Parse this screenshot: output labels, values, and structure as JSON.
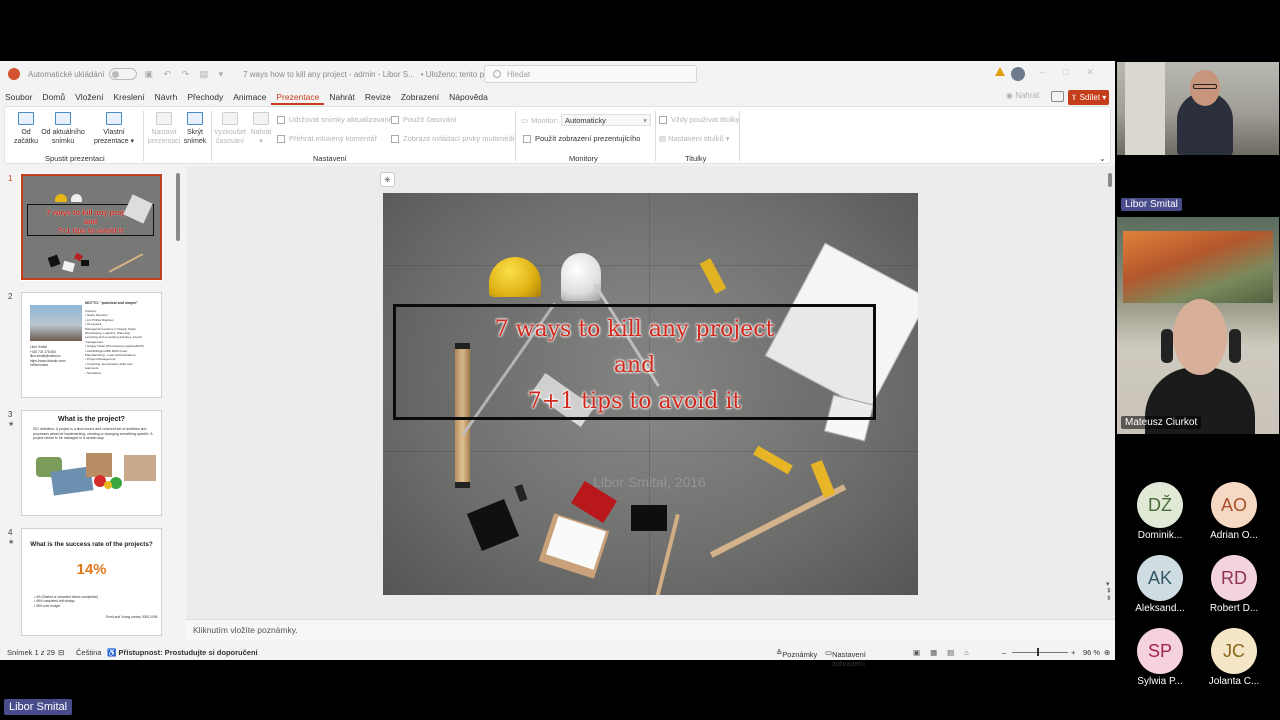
{
  "window": {
    "autosave_label": "Automatické ukládání",
    "doc_title": "7 ways how to kill any project - admin - Libor S...",
    "save_status": "• Uloženo: tento počítač",
    "search_placeholder": "Hledat"
  },
  "menu": {
    "items": [
      "Soubor",
      "Domů",
      "Vložení",
      "Kreslení",
      "Návrh",
      "Přechody",
      "Animace",
      "Prezentace",
      "Nahrát",
      "Revize",
      "Zobrazení",
      "Nápověda"
    ],
    "active": "Prezentace",
    "record_label": "Nahrát",
    "share_label": "Sdílet"
  },
  "ribbon": {
    "from_start": [
      "Od",
      "začátku"
    ],
    "from_current": [
      "Od aktuálního",
      "snímku"
    ],
    "custom": [
      "Vlastní",
      "prezentace"
    ],
    "group_start": "Spustit prezentaci",
    "setup": [
      "Nastavit",
      "prezentaci"
    ],
    "hide": [
      "Skrýt",
      "snímek"
    ],
    "rehearse": [
      "Vyzkoušet",
      "časování"
    ],
    "record": "Nahrát",
    "keep_updated": "Udržovat snímky aktualizované",
    "play_narrations": "Přehrát mluvený komentář",
    "use_timings": "Použít časování",
    "show_media_controls": "Zobrazit ovládací prvky multimédií",
    "group_setup": "Nastavení",
    "monitor_label": "Monitor:",
    "monitor_value": "Automaticky",
    "presenter_view": "Použít zobrazení prezentujícího",
    "group_monitors": "Monitory",
    "always_subtitles": "Vždy používat titulky",
    "subtitle_settings": "Nastavení titulků",
    "group_captions": "Titulky"
  },
  "thumbnails": [
    {
      "num": "1",
      "title": "7 ways to kill any project and 7+1 tips to avoid it"
    },
    {
      "num": "2",
      "title": "MOTTO: \"practical and simple\""
    },
    {
      "num": "3",
      "title": "What is the project?"
    },
    {
      "num": "4",
      "title": "What is the success rate of the projects?",
      "big": "14%"
    }
  ],
  "thumb_text": {
    "s2_left": [
      "Libor Smital",
      "+420 724 378 805",
      "libor.smital@smital.cz",
      "https://www.linkedin.com/",
      "in/liborsmital"
    ],
    "s2_right": [
      "Careers:",
      "• Nokia Siemens",
      "• LG Philips Displays",
      "• Honeywell",
      "Managerial positions in Supply Chain",
      "(Purchasing, Logistics, Planning)",
      "Lecturing and consulting activities, interim management:",
      "• Supply Chain (Purchasing Logistics/EOP)",
      "• LEAN/6sigma/BS 9000 (Lean",
      "  Manufacturing - Lean Administration)",
      "• Project Management",
      "• Coaching, presentation skills and",
      "  teamwork",
      "• Simulation"
    ],
    "s3_def": "ISO definition: A project is a time-bound and coherent set of activities and processes aimed at implementing, creating or changing something specific. A project needs to be managed in a certain way.",
    "s4_lines": [
      "• 4% (Started or cancelled before completion)",
      "• 48% completed with delays",
      "• 35% over budget"
    ],
    "s4_source": "Ernst and Young survey 2005-2006"
  },
  "slide": {
    "title_lines": [
      "7 ways to kill any project",
      "and",
      "7+1 tips to avoid it"
    ],
    "watermark": "Libor Smital, 2016"
  },
  "notes_placeholder": "Kliknutím vložíte poznámky.",
  "status": {
    "slide_counter": "Snímek 1 z 29",
    "language": "Čeština",
    "accessibility": "Přístupnost: Prostudujte si doporučení",
    "notes": "Poznámky",
    "display_settings": "Nastavení zobrazení",
    "zoom": "96 %"
  },
  "teams": {
    "speaker1": "Libor Smital",
    "speaker2": "Mateusz Ciurkot",
    "participants": [
      {
        "initials": "DŽ",
        "name": "Dominik...",
        "bg": "#dfe9d6",
        "fg": "#4b6b3a"
      },
      {
        "initials": "AO",
        "name": "Adrian O...",
        "bg": "#f6d9c4",
        "fg": "#a8502a"
      },
      {
        "initials": "AK",
        "name": "Aleksand...",
        "bg": "#cfdde2",
        "fg": "#325866"
      },
      {
        "initials": "RD",
        "name": "Robert D...",
        "bg": "#f3d3dc",
        "fg": "#8e3553"
      },
      {
        "initials": "SP",
        "name": "Sylwia P...",
        "bg": "#f6d2dd",
        "fg": "#a1244d"
      },
      {
        "initials": "JC",
        "name": "Jolanta C...",
        "bg": "#f4e6c6",
        "fg": "#8a6619"
      }
    ],
    "presenter_label": "Libor Smital"
  },
  "colors": {
    "accent": "#c43e1c",
    "slide_title": "#d0281c",
    "name_tag": "#4a4d8c"
  }
}
